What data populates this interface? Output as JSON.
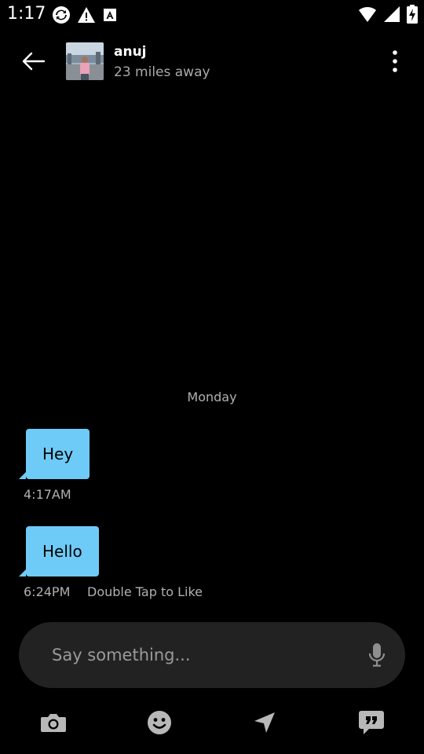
{
  "status_bar": {
    "time": "1:17",
    "left_icons": [
      "sync-icon",
      "warning-icon",
      "font-a-icon"
    ],
    "right_icons": [
      "wifi-icon",
      "signal-icon",
      "battery-charging-icon"
    ]
  },
  "header": {
    "contact_name": "anuj",
    "distance": "23 miles away"
  },
  "chat": {
    "day_label": "Monday",
    "messages": [
      {
        "text": "Hey",
        "time": "4:17AM",
        "hint": ""
      },
      {
        "text": "Hello",
        "time": "6:24PM",
        "hint": "Double Tap to Like"
      }
    ]
  },
  "composer": {
    "placeholder": "Say something..."
  },
  "toolbar": {
    "items": [
      "camera-icon",
      "smiley-icon",
      "location-icon",
      "saved-phrases-icon"
    ]
  },
  "colors": {
    "background": "#000000",
    "bubble": "#6ecbf7",
    "composer_bg": "#222222",
    "muted_text": "#b0b0b0",
    "toolbar_icon": "#b8b8b8"
  }
}
